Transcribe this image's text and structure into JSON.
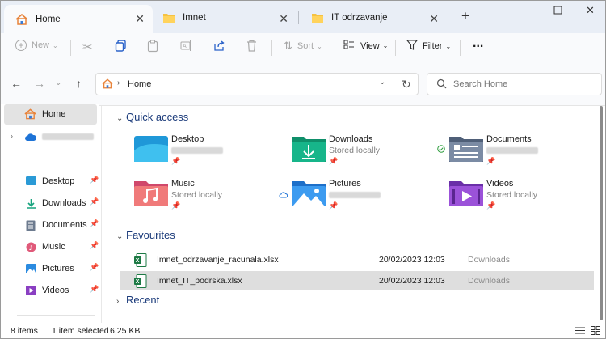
{
  "tabs": [
    {
      "label": "Home",
      "active": true
    },
    {
      "label": "Imnet",
      "active": false
    },
    {
      "label": "IT odrzavanje",
      "active": false
    }
  ],
  "toolbar": {
    "new_label": "New",
    "sort_label": "Sort",
    "view_label": "View",
    "filter_label": "Filter",
    "more_label": "..."
  },
  "address": {
    "crumb": "Home"
  },
  "search": {
    "placeholder": "Search Home"
  },
  "sidebar": {
    "items": [
      {
        "label": "Home"
      },
      {
        "label": "Desktop"
      },
      {
        "label": "Downloads"
      },
      {
        "label": "Documents"
      },
      {
        "label": "Music"
      },
      {
        "label": "Pictures"
      },
      {
        "label": "Videos"
      }
    ]
  },
  "quick_access": {
    "title": "Quick access",
    "tiles": [
      {
        "name": "Desktop",
        "sub": ""
      },
      {
        "name": "Downloads",
        "sub": "Stored locally"
      },
      {
        "name": "Documents",
        "sub": ""
      },
      {
        "name": "Music",
        "sub": "Stored locally"
      },
      {
        "name": "Pictures",
        "sub": ""
      },
      {
        "name": "Videos",
        "sub": "Stored locally"
      }
    ]
  },
  "favourites": {
    "title": "Favourites",
    "files": [
      {
        "name": "Imnet_odrzavanje_racunala.xlsx",
        "date": "20/02/2023 12:03",
        "location": "Downloads"
      },
      {
        "name": "Imnet_IT_podrska.xlsx",
        "date": "20/02/2023 12:03",
        "location": "Downloads"
      }
    ]
  },
  "recent": {
    "title": "Recent"
  },
  "status": {
    "items": "8 items",
    "selected": "1 item selected",
    "size": "6,25 KB"
  },
  "colors": {
    "accent": "#1a3a7a",
    "tabbar": "#e9eef6",
    "selected": "#dedede"
  }
}
